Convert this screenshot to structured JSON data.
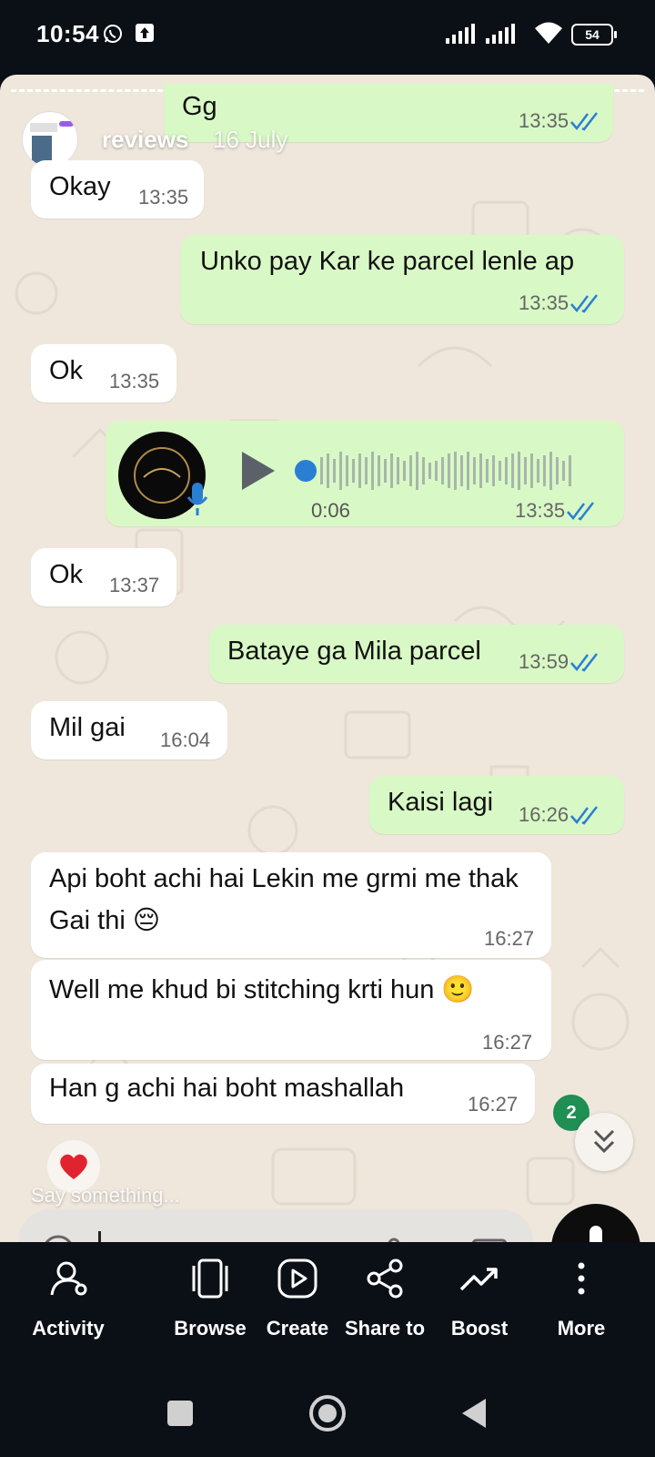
{
  "status_bar": {
    "time": "10:54",
    "battery": "54"
  },
  "story": {
    "username": "reviews",
    "date": "16 July"
  },
  "messages": [
    {
      "text": "Gg",
      "time": "13:35"
    },
    {
      "text": "Okay",
      "time": "13:35"
    },
    {
      "text": "Unko pay Kar ke parcel lenle ap",
      "time": "13:35"
    },
    {
      "text": "Ok",
      "time": "13:35"
    },
    {
      "duration": "0:06",
      "time": "13:35"
    },
    {
      "text": "Ok",
      "time": "13:37"
    },
    {
      "text": "Bataye ga Mila parcel",
      "time": "13:59"
    },
    {
      "text": "Mil gai",
      "time": "16:04"
    },
    {
      "text": "Kaisi lagi",
      "time": "16:26"
    },
    {
      "text": "Api boht achi hai Lekin me grmi me thak Gai thi 😔",
      "time": "16:27"
    },
    {
      "text": "Well me khud bi stitching krti hun 🙂",
      "time": "16:27"
    },
    {
      "text": "Han g achi hai boht mashallah",
      "time": "16:27"
    }
  ],
  "unread_count": "2",
  "reply": {
    "placeholder": "Say something..."
  },
  "actions": [
    {
      "label": "Activity",
      "icon": "activity-icon"
    },
    {
      "label": "Browse",
      "icon": "browse-icon"
    },
    {
      "label": "Create",
      "icon": "create-icon"
    },
    {
      "label": "Share to",
      "icon": "share-icon"
    },
    {
      "label": "Boost",
      "icon": "boost-icon"
    },
    {
      "label": "More",
      "icon": "more-icon"
    }
  ],
  "colors": {
    "incoming": "#ffffff",
    "outgoing": "#d8f9c5",
    "tick": "#2a7fd4",
    "background": "#efe7dc"
  }
}
